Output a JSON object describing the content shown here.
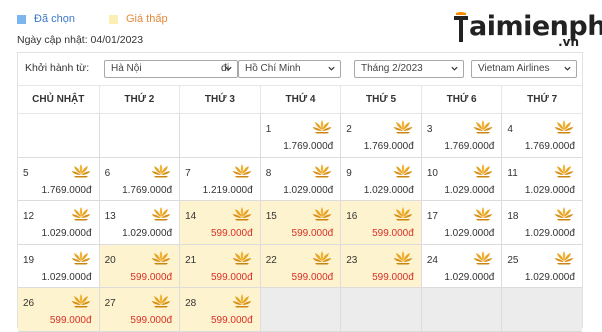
{
  "legend": {
    "selected_label": "Đã chọn",
    "cheap_label": "Giá thấp",
    "selected_color": "#7bb6ef",
    "cheap_color": "#fcefb4"
  },
  "updated_text": "Ngày cập nhật: 04/01/2023",
  "logo": {
    "main": "aimienphi",
    "suffix": ".vn",
    "brand_icon": "taimienphi-logo"
  },
  "filters": {
    "from_label": "Khởi hành từ:",
    "from_value": "Hà Nội",
    "to_label": "đi",
    "to_value": "Hồ Chí Minh",
    "month_value": "Tháng 2/2023",
    "airline_value": "Vietnam Airlines"
  },
  "calendar": {
    "weekdays": [
      "CHỦ NHẬT",
      "THỨ 2",
      "THỨ 3",
      "THỨ 4",
      "THỨ 5",
      "THỨ 6",
      "THỨ 7"
    ],
    "price_icon": "lotus-icon",
    "price_color_cheap": "#d93025",
    "weeks": [
      [
        {
          "type": "blank"
        },
        {
          "type": "blank"
        },
        {
          "type": "blank"
        },
        {
          "type": "day",
          "day": "1",
          "price": "1.769.000đ",
          "cheap": false
        },
        {
          "type": "day",
          "day": "2",
          "price": "1.769.000đ",
          "cheap": false
        },
        {
          "type": "day",
          "day": "3",
          "price": "1.769.000đ",
          "cheap": false
        },
        {
          "type": "day",
          "day": "4",
          "price": "1.769.000đ",
          "cheap": false
        }
      ],
      [
        {
          "type": "day",
          "day": "5",
          "price": "1.769.000đ",
          "cheap": false
        },
        {
          "type": "day",
          "day": "6",
          "price": "1.769.000đ",
          "cheap": false
        },
        {
          "type": "day",
          "day": "7",
          "price": "1.219.000đ",
          "cheap": false
        },
        {
          "type": "day",
          "day": "8",
          "price": "1.029.000đ",
          "cheap": false
        },
        {
          "type": "day",
          "day": "9",
          "price": "1.029.000đ",
          "cheap": false
        },
        {
          "type": "day",
          "day": "10",
          "price": "1.029.000đ",
          "cheap": false
        },
        {
          "type": "day",
          "day": "11",
          "price": "1.029.000đ",
          "cheap": false
        }
      ],
      [
        {
          "type": "day",
          "day": "12",
          "price": "1.029.000đ",
          "cheap": false
        },
        {
          "type": "day",
          "day": "13",
          "price": "1.029.000đ",
          "cheap": false
        },
        {
          "type": "day",
          "day": "14",
          "price": "599.000đ",
          "cheap": true
        },
        {
          "type": "day",
          "day": "15",
          "price": "599.000đ",
          "cheap": true
        },
        {
          "type": "day",
          "day": "16",
          "price": "599.000đ",
          "cheap": true
        },
        {
          "type": "day",
          "day": "17",
          "price": "1.029.000đ",
          "cheap": false
        },
        {
          "type": "day",
          "day": "18",
          "price": "1.029.000đ",
          "cheap": false
        }
      ],
      [
        {
          "type": "day",
          "day": "19",
          "price": "1.029.000đ",
          "cheap": false
        },
        {
          "type": "day",
          "day": "20",
          "price": "599.000đ",
          "cheap": true
        },
        {
          "type": "day",
          "day": "21",
          "price": "599.000đ",
          "cheap": true
        },
        {
          "type": "day",
          "day": "22",
          "price": "599.000đ",
          "cheap": true
        },
        {
          "type": "day",
          "day": "23",
          "price": "599.000đ",
          "cheap": true
        },
        {
          "type": "day",
          "day": "24",
          "price": "1.029.000đ",
          "cheap": false
        },
        {
          "type": "day",
          "day": "25",
          "price": "1.029.000đ",
          "cheap": false
        }
      ],
      [
        {
          "type": "day",
          "day": "26",
          "price": "599.000đ",
          "cheap": true
        },
        {
          "type": "day",
          "day": "27",
          "price": "599.000đ",
          "cheap": true
        },
        {
          "type": "day",
          "day": "28",
          "price": "599.000đ",
          "cheap": true
        },
        {
          "type": "empty"
        },
        {
          "type": "empty"
        },
        {
          "type": "empty"
        },
        {
          "type": "empty"
        }
      ]
    ]
  }
}
